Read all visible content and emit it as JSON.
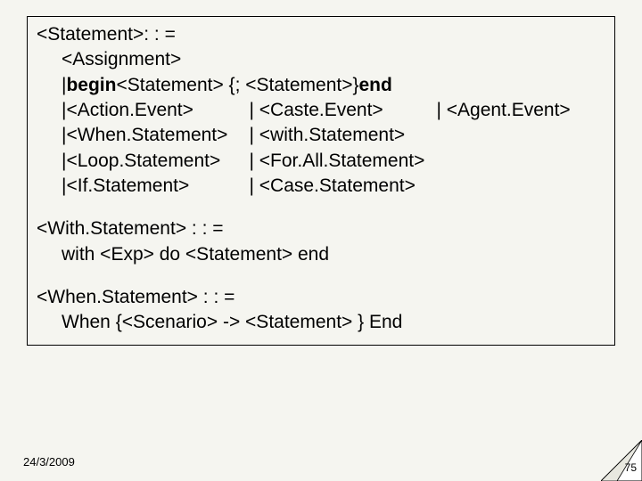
{
  "grammar": {
    "stmt_head": "<Statement>: : =",
    "assignment": "<Assignment>",
    "pipe": "| ",
    "begin_kw": "begin",
    "begin_mid": " <Statement> {; <Statement>} ",
    "end_kw": "end",
    "action_event": "<Action.Event>",
    "caste_event": "| <Caste.Event>",
    "agent_event": "| <Agent.Event>",
    "when_stmt": "<When.Statement>",
    "with_stmt_alt": "| <with.Statement>",
    "loop_stmt": "<Loop.Statement>",
    "forall_stmt": "| <For.All.Statement>",
    "if_stmt": "<If.Statement>",
    "case_stmt": "| <Case.Statement>",
    "with_head": "<With.Statement> : : =",
    "with_body": "with <Exp> do <Statement> end",
    "when_head": "<When.Statement> : : =",
    "when_body": "When {<Scenario> -> <Statement> } End"
  },
  "footer": {
    "date": "24/3/2009",
    "page": "75"
  }
}
